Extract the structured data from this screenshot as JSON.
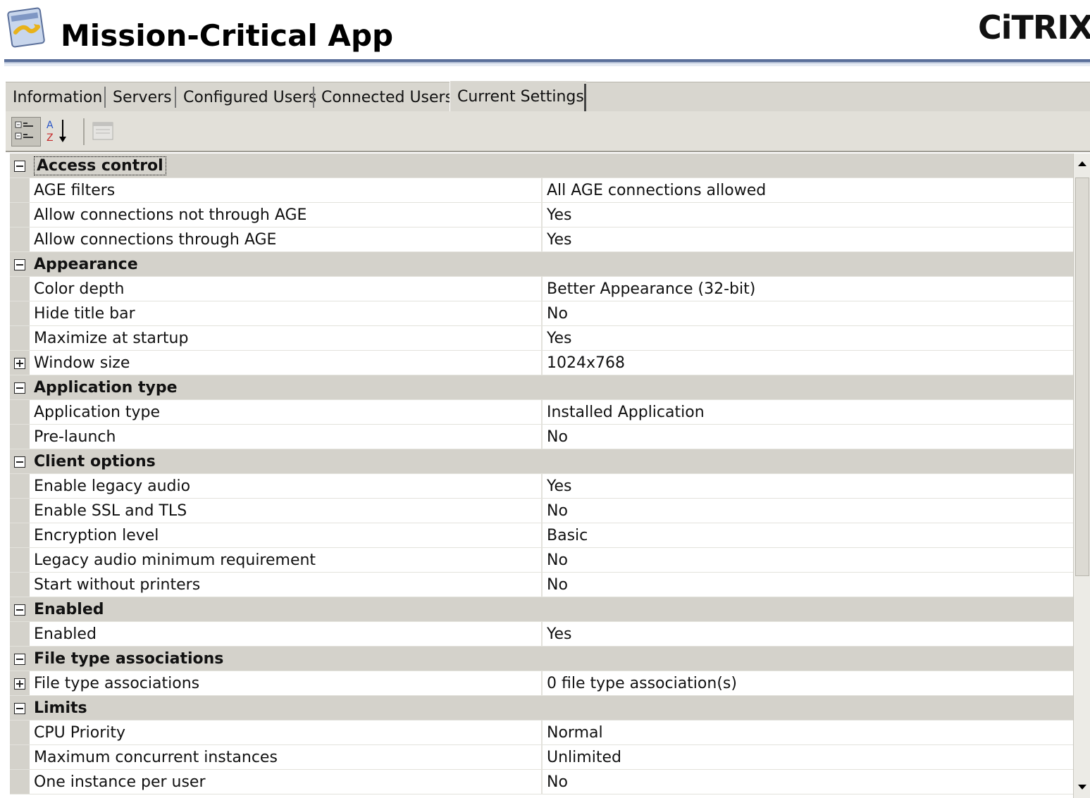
{
  "header": {
    "title": "Mission-Critical App",
    "logo_text": "CiTRIX",
    "icon": "application-icon"
  },
  "tabs": [
    {
      "label": "Information",
      "active": false
    },
    {
      "label": "Servers",
      "active": false
    },
    {
      "label": "Configured Users",
      "active": false
    },
    {
      "label": "Connected Users",
      "active": false
    },
    {
      "label": "Current Settings",
      "active": true
    }
  ],
  "toolbar": {
    "buttons": [
      {
        "icon": "categorized-view-icon",
        "pressed": true
      },
      {
        "icon": "sort-alphabetical-icon",
        "pressed": false
      },
      {
        "icon": "property-pages-icon",
        "enabled": false
      }
    ]
  },
  "grid": {
    "rows": [
      {
        "type": "category",
        "label": "Access control",
        "expanded": true,
        "focused": true
      },
      {
        "type": "item",
        "name": "AGE filters",
        "value": "All AGE connections allowed"
      },
      {
        "type": "item",
        "name": "Allow connections not through AGE",
        "value": "Yes"
      },
      {
        "type": "item",
        "name": "Allow connections through AGE",
        "value": "Yes"
      },
      {
        "type": "category",
        "label": "Appearance",
        "expanded": true
      },
      {
        "type": "item",
        "name": "Color depth",
        "value": "Better Appearance (32-bit)"
      },
      {
        "type": "item",
        "name": "Hide title bar",
        "value": "No"
      },
      {
        "type": "item",
        "name": "Maximize at startup",
        "value": "Yes"
      },
      {
        "type": "item",
        "name": "Window size",
        "value": "1024x768",
        "expandable": true
      },
      {
        "type": "category",
        "label": "Application type",
        "expanded": true
      },
      {
        "type": "item",
        "name": "Application type",
        "value": "Installed Application"
      },
      {
        "type": "item",
        "name": "Pre-launch",
        "value": "No"
      },
      {
        "type": "category",
        "label": "Client options",
        "expanded": true
      },
      {
        "type": "item",
        "name": "Enable legacy audio",
        "value": "Yes"
      },
      {
        "type": "item",
        "name": "Enable SSL and TLS",
        "value": "No"
      },
      {
        "type": "item",
        "name": "Encryption level",
        "value": "Basic"
      },
      {
        "type": "item",
        "name": "Legacy audio minimum requirement",
        "value": "No"
      },
      {
        "type": "item",
        "name": "Start without printers",
        "value": "No"
      },
      {
        "type": "category",
        "label": "Enabled",
        "expanded": true
      },
      {
        "type": "item",
        "name": "Enabled",
        "value": "Yes"
      },
      {
        "type": "category",
        "label": "File type associations",
        "expanded": true
      },
      {
        "type": "item",
        "name": "File type associations",
        "value": "0 file type association(s)",
        "expandable": true
      },
      {
        "type": "category",
        "label": "Limits",
        "expanded": true
      },
      {
        "type": "item",
        "name": "CPU Priority",
        "value": "Normal"
      },
      {
        "type": "item",
        "name": "Maximum concurrent instances",
        "value": "Unlimited"
      },
      {
        "type": "item",
        "name": "One instance per user",
        "value": "No"
      }
    ]
  },
  "colors": {
    "header_rule": "#5a6f9a",
    "category_band": "#d4d2cb",
    "tab_strip": "#d8d6cf"
  }
}
